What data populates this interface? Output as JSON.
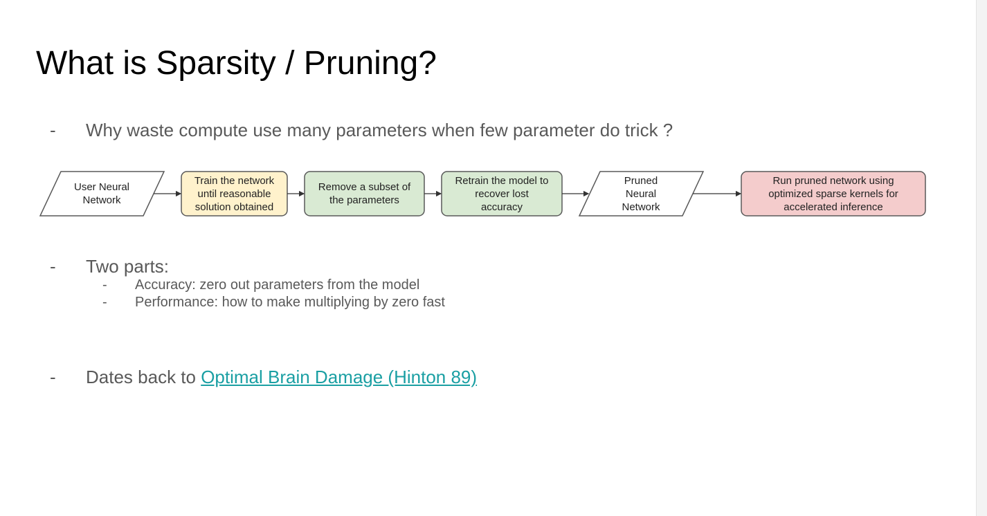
{
  "slide": {
    "title": "What is Sparsity / Pruning?",
    "bullets": {
      "b1": {
        "dash": "-",
        "text": "Why waste compute use many parameters when few parameter do trick ?"
      },
      "b2": {
        "dash": "-",
        "text": "Two parts:"
      },
      "b2a": {
        "dash": "-",
        "text": "Accuracy: zero out parameters from the model"
      },
      "b2b": {
        "dash": "-",
        "text": "Performance: how to make multiplying by zero fast"
      },
      "b3": {
        "dash": "-",
        "prefix": "Dates back to ",
        "link": "Optimal Brain Damage (Hinton 89)"
      }
    }
  },
  "diagram": {
    "nodes": [
      {
        "line1": "User Neural",
        "line2": "Network",
        "line3": "",
        "shape": "parallelogram",
        "fill": "#ffffff"
      },
      {
        "line1": "Train the network",
        "line2": "until reasonable",
        "line3": "solution obtained",
        "shape": "rounded-rect",
        "fill": "#fff2cc"
      },
      {
        "line1": "Remove a subset of",
        "line2": "the parameters",
        "line3": "",
        "shape": "rounded-rect",
        "fill": "#d9ead3"
      },
      {
        "line1": "Retrain the model to",
        "line2": "recover lost",
        "line3": "accuracy",
        "shape": "rounded-rect",
        "fill": "#d9ead3"
      },
      {
        "line1": "Pruned",
        "line2": "Neural",
        "line3": "Network",
        "shape": "parallelogram",
        "fill": "#ffffff"
      },
      {
        "line1": "Run pruned network using",
        "line2": "optimized sparse kernels for",
        "line3": "accelerated inference",
        "shape": "rounded-rect",
        "fill": "#f4cccc"
      }
    ]
  },
  "colors": {
    "body_text": "#595959",
    "title_text": "#000000",
    "link": "#1a9fa3",
    "stroke": "#595959"
  }
}
